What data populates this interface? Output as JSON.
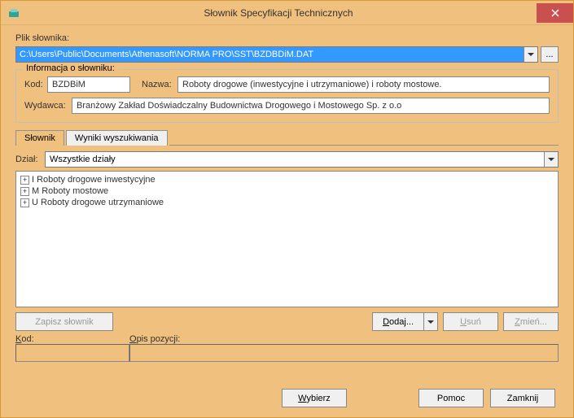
{
  "titlebar": {
    "title": "Słownik Specyfikacji Technicznych"
  },
  "file": {
    "label": "Plik słownika:",
    "path": "C:\\Users\\Public\\Documents\\Athenasoft\\NORMA PRO\\SST\\BZDBDiM.DAT",
    "browse": "..."
  },
  "info": {
    "group_title": "Informacja o słowniku:",
    "kod_label": "Kod:",
    "kod_value": "BZDBiM",
    "nazwa_label": "Nazwa:",
    "nazwa_value": "Roboty drogowe (inwestycyjne i utrzymaniowe) i roboty mostowe.",
    "wydawca_label": "Wydawca:",
    "wydawca_value": "Branżowy Zakład Doświadczalny Budownictwa Drogowego i Mostowego Sp. z o.o"
  },
  "tabs": {
    "slownik": "Słownik",
    "wyniki": "Wyniki wyszukiwania"
  },
  "dzial": {
    "label": "Dział:",
    "value": "Wszystkie działy"
  },
  "tree": {
    "items": [
      {
        "label": "I  Roboty drogowe inwestycyjne"
      },
      {
        "label": "M  Roboty mostowe"
      },
      {
        "label": "U  Roboty drogowe utrzymaniowe"
      }
    ]
  },
  "buttons": {
    "zapisz": "Zapisz słownik",
    "dodaj": "Dodaj...",
    "usun": "Usuń",
    "zmien": "Zmień..."
  },
  "bottom": {
    "kod_label": "Kod:",
    "opis_label": "Opis pozycji:"
  },
  "footer": {
    "wybierz": "Wybierz",
    "pomoc": "Pomoc",
    "zamknij": "Zamknij"
  }
}
